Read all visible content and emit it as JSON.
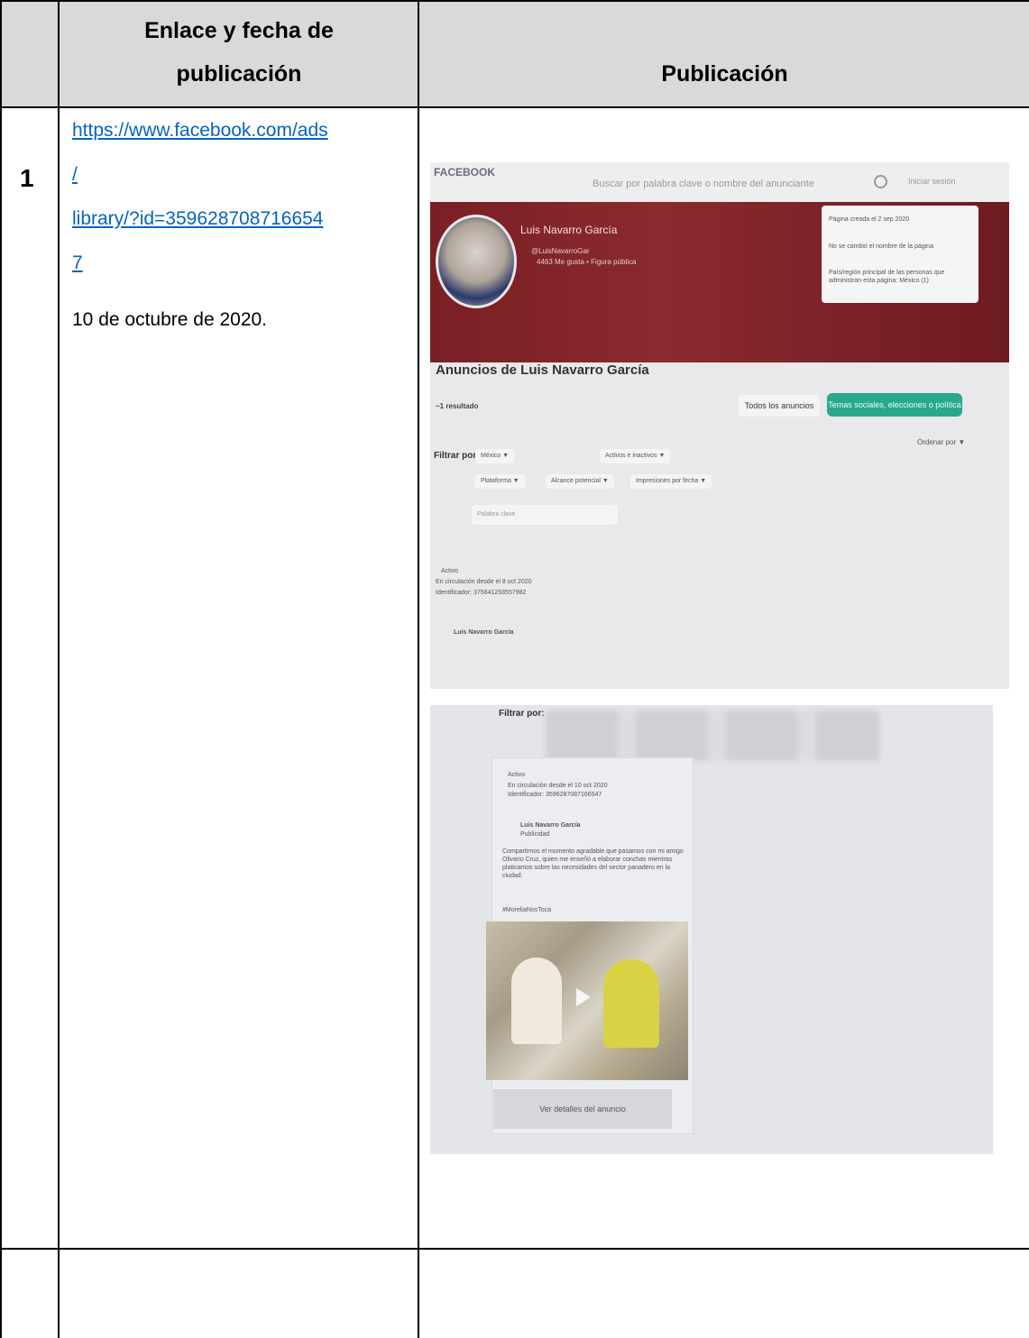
{
  "header": {
    "col_link_line1": "Enlace y fecha de",
    "col_link_line2": "publicación",
    "col_publication": "Publicación"
  },
  "rows": [
    {
      "number": "1",
      "link_lines": [
        "https://www.facebook.com/ads",
        "/",
        "library/?id=359628708716654",
        "7"
      ],
      "date": "10 de octubre de 2020."
    }
  ],
  "photo1": {
    "logo": "FACEBOOK",
    "search_placeholder": "Buscar por palabra clave o nombre del anunciante",
    "login": "Iniciar sesión",
    "page_name": "Luis Navarro García",
    "handle": "@LuisNavarroGar",
    "likes": "4463 Me gusta • Figura pública",
    "card_created": "Página creada el 2 sep 2020",
    "card_name": "No se cambió el nombre de la página",
    "card_region": "País/región principal de las personas que administran esta página: México (1)",
    "title": "Anuncios de Luis Navarro García",
    "results": "~1 resultado",
    "btn_all": "Todos los anuncios",
    "btn_topics": "Temas sociales, elecciones o política",
    "filter_label": "Filtrar por:",
    "chip_country": "México ▼",
    "chip_active": "Activos e inactivos ▼",
    "chip_platform": "Plataforma ▼",
    "chip_reach": "Alcance potencial ▼",
    "chip_impressions": "Impresiones por fecha ▼",
    "sort": "Ordenar por ▼",
    "keyword_placeholder": "Palabra clave",
    "ad_status": "Activo",
    "ad_running": "En circulación desde el 8 oct 2020",
    "ad_id": "Identificador: 375641293557982",
    "ad_author": "Luis Navarro García"
  },
  "photo2": {
    "filter_label": "Filtrar por:",
    "ad_status": "Activo",
    "ad_running": "En circulación desde el 10 oct 2020",
    "ad_id": "Identificador: 3596287087166547",
    "ad_author": "Luis Navarro García",
    "ad_author_sub": "Publicidad",
    "post_text": "Compartimos el momento agradable que pasamos con mi amigo Olivario Cruz, quien me enseñó a elaborar conchas mientras platicamos sobre las necesidades del sector panadero en la ciudad.",
    "hashtag": "#MoreliaNosToca",
    "details_button": "Ver detalles del anuncio"
  }
}
